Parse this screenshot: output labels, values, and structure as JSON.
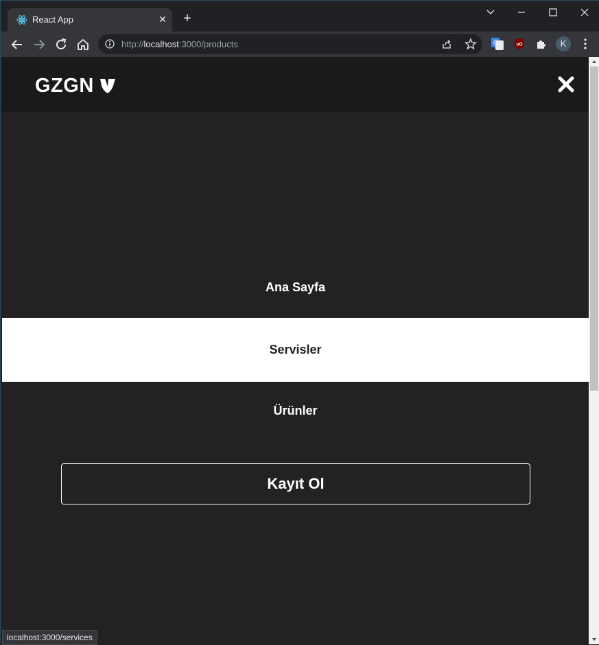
{
  "browser": {
    "tab_title": "React App",
    "url_prefix": "http://",
    "url_host": "localhost",
    "url_rest": ":3000/products",
    "profile_initial": "K",
    "status_url": "localhost:3000/services"
  },
  "site": {
    "logo_text": "GZGN",
    "menu": [
      {
        "label": "Ana Sayfa",
        "active": false
      },
      {
        "label": "Servisler",
        "active": true
      },
      {
        "label": "Ürünler",
        "active": false
      }
    ],
    "signup_label": "Kayıt Ol"
  },
  "colors": {
    "page_bg": "#242122",
    "header_bg": "#1a1a1a",
    "active_item_bg": "#ffffff",
    "text": "#ffffff"
  }
}
